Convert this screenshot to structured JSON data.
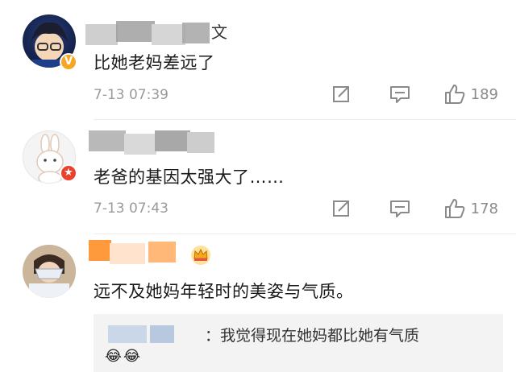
{
  "comments": [
    {
      "name_tail": "文",
      "text": "比她老妈差远了",
      "time": "7-13 07:39",
      "likes": "189",
      "colors": {
        "badge": "#f5a623"
      }
    },
    {
      "text": "老爸的基因太强大了……",
      "time": "7-13 07:43",
      "likes": "178",
      "colors": {
        "badge": "#e8412c"
      }
    },
    {
      "text": "远不及她妈年轻时的美姿与气质。",
      "reply": {
        "text": "：我觉得现在她妈都比她有气质",
        "emoji": "😂😂"
      }
    }
  ]
}
